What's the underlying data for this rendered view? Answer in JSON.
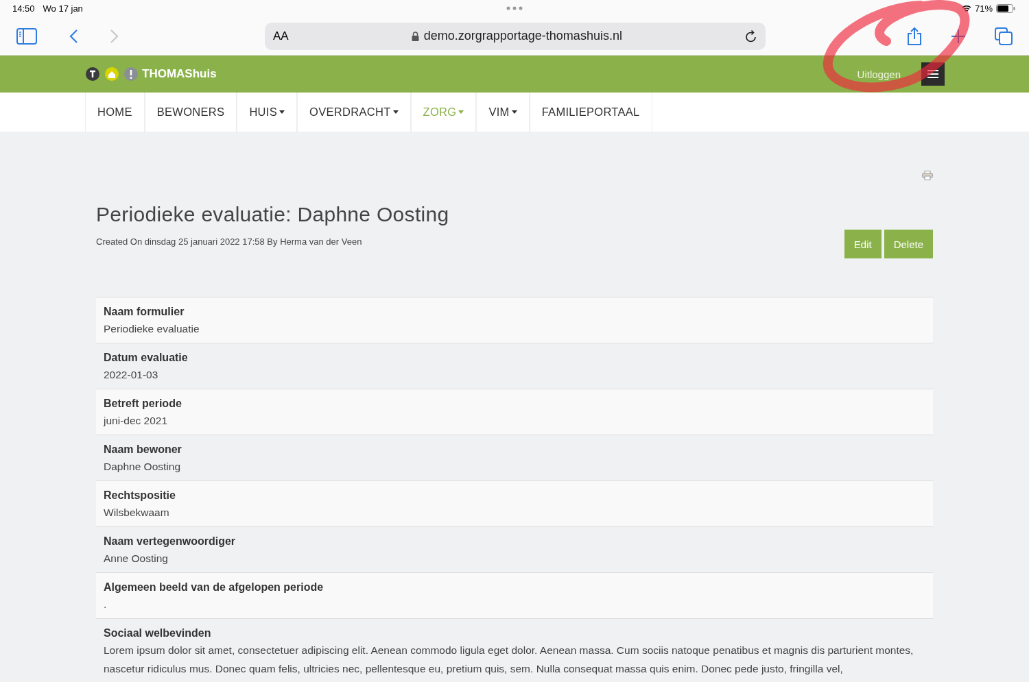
{
  "status_bar": {
    "time": "14:50",
    "date": "Wo 17 jan",
    "battery": "71%"
  },
  "browser": {
    "text_size": "AA",
    "url": "demo.zorgrapportage-thomashuis.nl"
  },
  "header": {
    "brand": "THOMAShuis",
    "logout": "Uitloggen"
  },
  "nav": [
    {
      "label": "HOME",
      "dropdown": false,
      "selected": false
    },
    {
      "label": "BEWONERS",
      "dropdown": false,
      "selected": false
    },
    {
      "label": "HUIS",
      "dropdown": true,
      "selected": false
    },
    {
      "label": "OVERDRACHT",
      "dropdown": true,
      "selected": false
    },
    {
      "label": "ZORG",
      "dropdown": true,
      "selected": true
    },
    {
      "label": "VIM",
      "dropdown": true,
      "selected": false
    },
    {
      "label": "FAMILIEPORTAAL",
      "dropdown": false,
      "selected": false
    }
  ],
  "page": {
    "title": "Periodieke evaluatie: Daphne Oosting",
    "meta": "Created On dinsdag 25 januari 2022 17:58 By Herma van der Veen",
    "buttons": [
      "Edit",
      "Delete"
    ]
  },
  "fields": [
    {
      "label": "Naam formulier",
      "value": "Periodieke evaluatie"
    },
    {
      "label": "Datum evaluatie",
      "value": "2022-01-03"
    },
    {
      "label": "Betreft periode",
      "value": "juni-dec 2021"
    },
    {
      "label": "Naam bewoner",
      "value": "Daphne Oosting"
    },
    {
      "label": "Rechtspositie",
      "value": "Wilsbekwaam"
    },
    {
      "label": "Naam vertegenwoordiger",
      "value": "Anne Oosting"
    },
    {
      "label": "Algemeen beeld van de afgelopen periode",
      "value": "."
    },
    {
      "label": "Sociaal welbevinden",
      "value": "Lorem ipsum dolor sit amet, consectetuer adipiscing elit. Aenean commodo ligula eget dolor. Aenean massa. Cum sociis natoque penatibus et magnis dis parturient montes, nascetur ridiculus mus. Donec quam felis, ultricies nec, pellentesque eu, pretium quis, sem. Nulla consequat massa quis enim. Donec pede justo, fringilla vel,"
    }
  ]
}
